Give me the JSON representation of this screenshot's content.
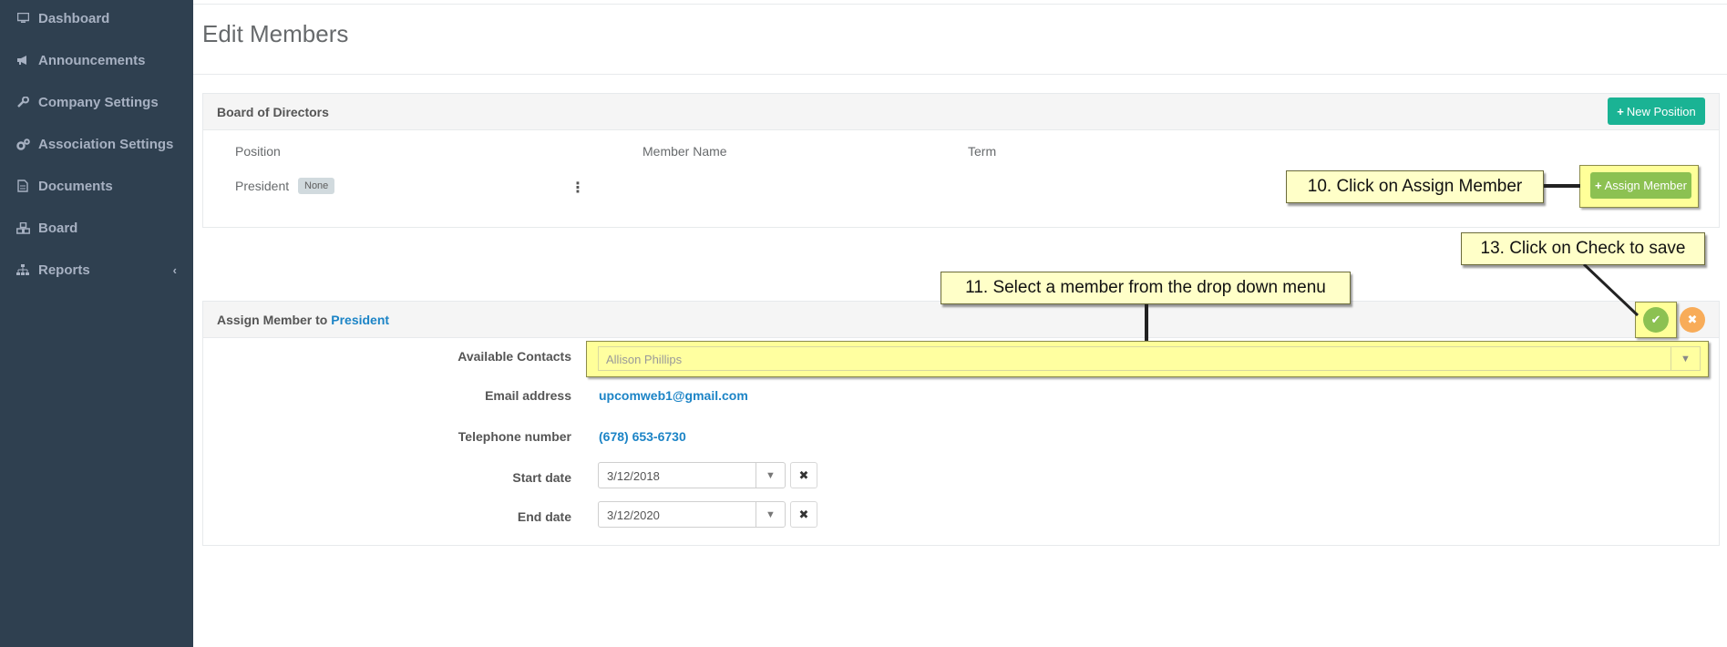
{
  "sidebar": {
    "items": [
      {
        "label": "Dashboard",
        "icon": "monitor-icon"
      },
      {
        "label": "Announcements",
        "icon": "bullhorn-icon"
      },
      {
        "label": "Company Settings",
        "icon": "wrench-icon"
      },
      {
        "label": "Association Settings",
        "icon": "gears-icon"
      },
      {
        "label": "Documents",
        "icon": "document-icon"
      },
      {
        "label": "Board",
        "icon": "cubes-icon"
      },
      {
        "label": "Reports",
        "icon": "sitemap-icon",
        "chevron": "‹"
      }
    ]
  },
  "page": {
    "title": "Edit Members"
  },
  "board_panel": {
    "title": "Board of Directors",
    "new_position_label": "New Position",
    "columns": [
      "Position",
      "Member Name",
      "Term"
    ],
    "rows": [
      {
        "position": "President",
        "badge": "None",
        "menu": "⋮"
      }
    ],
    "assign_member_label": "Assign Member"
  },
  "assign_panel": {
    "title_prefix": "Assign Member to",
    "title_position": "President",
    "fields": {
      "available_contacts_label": "Available Contacts",
      "available_contacts_value": "Allison Phillips",
      "email_label": "Email address",
      "email_value": "upcomweb1@gmail.com",
      "phone_label": "Telephone number",
      "phone_value": "(678) 653-6730",
      "start_label": "Start date",
      "start_value": "3/12/2018",
      "end_label": "End date",
      "end_value": "3/12/2020"
    }
  },
  "callouts": {
    "step10": "10. Click on Assign Member",
    "step11": "11. Select a member from the drop down menu",
    "step13": "13. Click on Check to save"
  },
  "colors": {
    "sidebar_bg": "#2f4050",
    "primary_green": "#1ab394",
    "assign_green": "#8cc152",
    "link_blue": "#1c84c6",
    "save_green": "#8cc152",
    "cancel_orange": "#f8ac59",
    "highlight_yellow": "#ffff99"
  }
}
